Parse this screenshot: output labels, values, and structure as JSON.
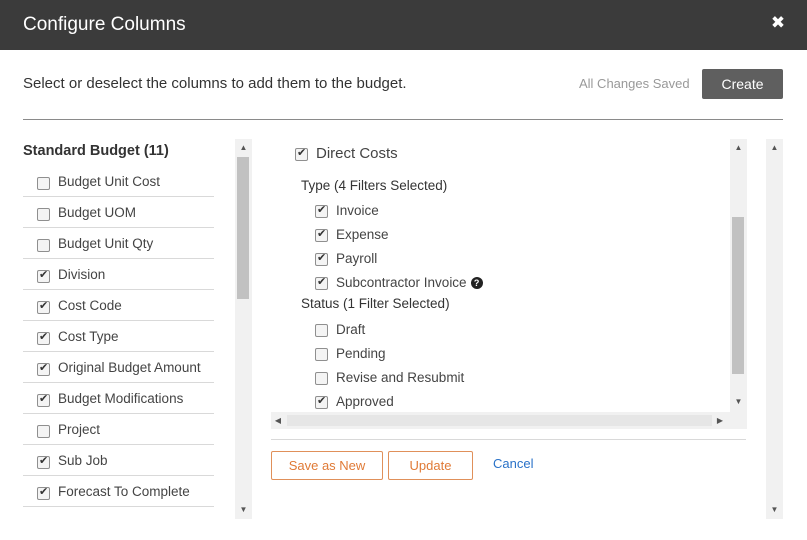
{
  "dialog": {
    "title": "Configure Columns",
    "close_symbol": "✖",
    "instructions": "Select or deselect the columns to add them to the budget.",
    "save_status": "All Changes Saved",
    "create_label": "Create"
  },
  "left_panel": {
    "title": "Standard Budget (11)",
    "items": [
      {
        "label": "Budget Unit Cost",
        "checked": false
      },
      {
        "label": "Budget UOM",
        "checked": false
      },
      {
        "label": "Budget Unit Qty",
        "checked": false
      },
      {
        "label": "Division",
        "checked": true
      },
      {
        "label": "Cost Code",
        "checked": true
      },
      {
        "label": "Cost Type",
        "checked": true
      },
      {
        "label": "Original Budget Amount",
        "checked": true
      },
      {
        "label": "Budget Modifications",
        "checked": true
      },
      {
        "label": "Project",
        "checked": false
      },
      {
        "label": "Sub Job",
        "checked": true
      },
      {
        "label": "Forecast To Complete",
        "checked": true
      }
    ]
  },
  "right_panel": {
    "main_item": {
      "label": "Direct Costs",
      "checked": true
    },
    "type_section": {
      "title": "Type (4 Filters Selected)",
      "items": [
        {
          "label": "Invoice",
          "checked": true
        },
        {
          "label": "Expense",
          "checked": true
        },
        {
          "label": "Payroll",
          "checked": true
        },
        {
          "label": "Subcontractor Invoice",
          "checked": true,
          "help_icon": "?"
        }
      ]
    },
    "status_section": {
      "title": "Status (1 Filter Selected)",
      "items": [
        {
          "label": "Draft",
          "checked": false
        },
        {
          "label": "Pending",
          "checked": false
        },
        {
          "label": "Revise and Resubmit",
          "checked": false
        },
        {
          "label": "Approved",
          "checked": true
        }
      ]
    }
  },
  "actions": {
    "save_as_new_label": "Save as New",
    "update_label": "Update",
    "cancel_label": "Cancel"
  },
  "colors": {
    "header_bg": "#3b3b3b",
    "accent_orange": "#e07a36",
    "link_blue": "#2a72c8",
    "create_button_bg": "#5f5f5f"
  },
  "icons": {
    "close": "close-icon",
    "checkbox": "checkmark-icon",
    "help": "question-circle-icon",
    "scroll_up": "arrow-up-icon",
    "scroll_down": "arrow-down-icon"
  }
}
